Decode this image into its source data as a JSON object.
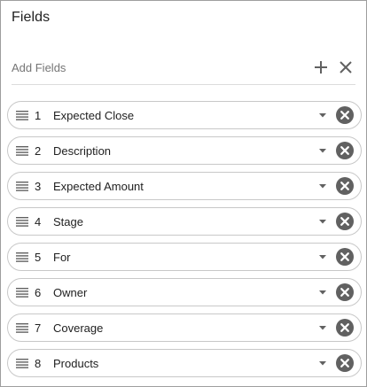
{
  "panel": {
    "title": "Fields",
    "add_label": "Add Fields",
    "add_icon": "plus-icon",
    "clear_icon": "close-icon"
  },
  "fields": [
    {
      "num": "1",
      "label": "Expected Close"
    },
    {
      "num": "2",
      "label": "Description"
    },
    {
      "num": "3",
      "label": "Expected Amount"
    },
    {
      "num": "4",
      "label": "Stage"
    },
    {
      "num": "5",
      "label": "For"
    },
    {
      "num": "6",
      "label": "Owner"
    },
    {
      "num": "7",
      "label": "Coverage"
    },
    {
      "num": "8",
      "label": "Products"
    }
  ],
  "icons": {
    "drag": "drag-handle-icon",
    "dropdown": "caret-down-icon",
    "remove": "remove-circle-icon"
  },
  "colors": {
    "remove_fill": "#616161",
    "row_border": "#c8c8c8",
    "panel_border": "#9e9e9e"
  }
}
